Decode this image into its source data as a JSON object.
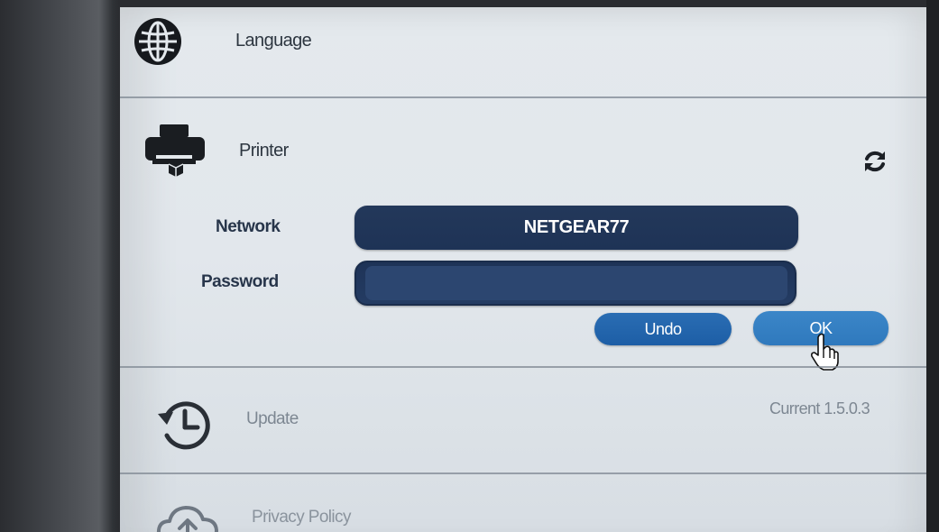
{
  "settings": {
    "language": {
      "label": "Language",
      "icon": "globe-icon"
    },
    "printer": {
      "label": "Printer",
      "icon": "printer-icon",
      "refresh_icon": "refresh-icon",
      "network_label": "Network",
      "network_value": "NETGEAR77",
      "password_label": "Password",
      "password_value": "",
      "undo_label": "Undo",
      "ok_label": "OK"
    },
    "update": {
      "label": "Update",
      "icon": "clock-history-icon",
      "version": "Current 1.5.0.3"
    },
    "privacy": {
      "label": "Privacy Policy",
      "icon": "cloud-upload-icon"
    }
  },
  "colors": {
    "panel_bg": "#e2e7ec",
    "field_dark": "#1e3356",
    "button_blue": "#1d5ea6",
    "button_ok": "#2f79bd"
  }
}
